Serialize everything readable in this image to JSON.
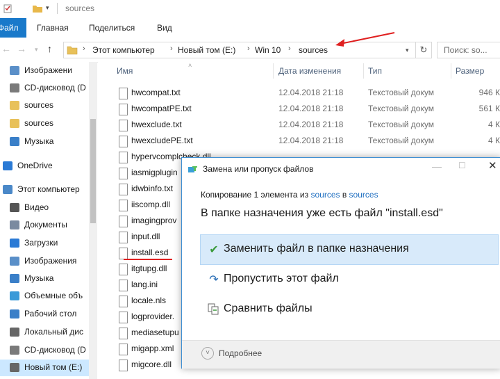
{
  "window": {
    "title": "sources"
  },
  "ribbon": {
    "tabs": [
      "Файл",
      "Главная",
      "Поделиться",
      "Вид"
    ]
  },
  "address": {
    "crumbs": [
      "Этот компьютер",
      "Новый том (E:)",
      "Win 10",
      "sources"
    ],
    "search_placeholder": "Поиск: so..."
  },
  "sidebar": {
    "items": [
      {
        "label": "Изображени",
        "icon": "pictures-icon"
      },
      {
        "label": "CD-дисковод (D",
        "icon": "cd-drive-icon"
      },
      {
        "label": "sources",
        "icon": "folder-icon"
      },
      {
        "label": "sources",
        "icon": "folder-icon"
      },
      {
        "label": "Музыка",
        "icon": "music-icon"
      },
      {
        "label": "OneDrive",
        "icon": "onedrive-icon"
      },
      {
        "label": "Этот компьютер",
        "icon": "computer-icon"
      },
      {
        "label": "Видео",
        "icon": "video-icon"
      },
      {
        "label": "Документы",
        "icon": "documents-icon"
      },
      {
        "label": "Загрузки",
        "icon": "downloads-icon"
      },
      {
        "label": "Изображения",
        "icon": "pictures-icon"
      },
      {
        "label": "Музыка",
        "icon": "music-icon"
      },
      {
        "label": "Объемные объ",
        "icon": "3d-objects-icon"
      },
      {
        "label": "Рабочий стол",
        "icon": "desktop-icon"
      },
      {
        "label": "Локальный дис",
        "icon": "local-disk-icon"
      },
      {
        "label": "CD-дисковод (D",
        "icon": "cd-drive-icon"
      },
      {
        "label": "Новый том (E:)",
        "icon": "drive-icon"
      }
    ]
  },
  "columns": {
    "name": "Имя",
    "date": "Дата изменения",
    "type": "Тип",
    "size": "Размер"
  },
  "files": [
    {
      "name": "hwcompat.txt",
      "date": "12.04.2018 21:18",
      "type": "Текстовый докум",
      "size": "946 К"
    },
    {
      "name": "hwcompatPE.txt",
      "date": "12.04.2018 21:18",
      "type": "Текстовый докум",
      "size": "561 К"
    },
    {
      "name": "hwexclude.txt",
      "date": "12.04.2018 21:18",
      "type": "Текстовый докум",
      "size": "4 К"
    },
    {
      "name": "hwexcludePE.txt",
      "date": "12.04.2018 21:18",
      "type": "Текстовый докум",
      "size": "4 К"
    },
    {
      "name": "hypervcomplcheck.dll",
      "date": "",
      "type": "",
      "size": ""
    },
    {
      "name": "iasmigplugin",
      "date": "",
      "type": "",
      "size": ""
    },
    {
      "name": "idwbinfo.txt",
      "date": "",
      "type": "",
      "size": ""
    },
    {
      "name": "iiscomp.dll",
      "date": "",
      "type": "",
      "size": ""
    },
    {
      "name": "imagingprov",
      "date": "",
      "type": "",
      "size": ""
    },
    {
      "name": "input.dll",
      "date": "",
      "type": "",
      "size": ""
    },
    {
      "name": "install.esd",
      "date": "",
      "type": "",
      "size": ""
    },
    {
      "name": "itgtupg.dll",
      "date": "",
      "type": "",
      "size": ""
    },
    {
      "name": "lang.ini",
      "date": "",
      "type": "",
      "size": ""
    },
    {
      "name": "locale.nls",
      "date": "",
      "type": "",
      "size": ""
    },
    {
      "name": "logprovider.",
      "date": "",
      "type": "",
      "size": ""
    },
    {
      "name": "mediasetupu",
      "date": "",
      "type": "",
      "size": ""
    },
    {
      "name": "migapp.xml",
      "date": "",
      "type": "",
      "size": ""
    },
    {
      "name": "migcore.dll",
      "date": "",
      "type": "",
      "size": ""
    }
  ],
  "dialog": {
    "title": "Замена или пропуск файлов",
    "copy_prefix": "Копирование 1 элемента из ",
    "copy_src": "sources",
    "copy_mid": " в ",
    "copy_dst": "sources",
    "exists_text": "В папке назначения уже есть файл \"install.esd\"",
    "options": [
      {
        "label": "Заменить файл в папке назначения",
        "icon": "checkmark-icon"
      },
      {
        "label": "Пропустить этот файл",
        "icon": "skip-arrow-icon"
      },
      {
        "label": "Сравнить файлы",
        "icon": "compare-files-icon"
      }
    ],
    "more_label": "Подробнее"
  },
  "colors": {
    "accent": "#1979ca",
    "selection": "#cce8ff",
    "link": "#1f6fc1",
    "annotation": "#e02020"
  }
}
